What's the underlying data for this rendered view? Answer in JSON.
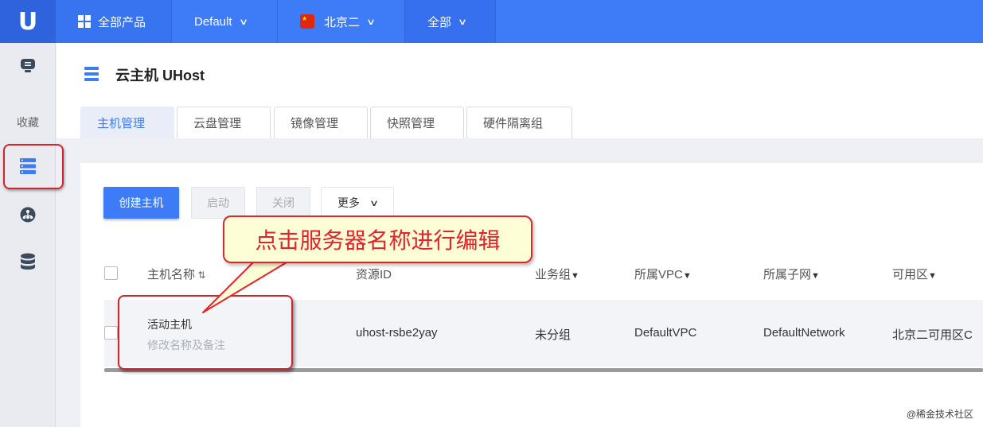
{
  "topbar": {
    "logo": "U",
    "products_label": "全部产品",
    "project_label": "Default",
    "region_label": "北京二",
    "scope_label": "全部"
  },
  "sidebar": {
    "favorites_label": "收藏"
  },
  "page": {
    "title": "云主机 UHost"
  },
  "tabs": [
    {
      "label": "主机管理"
    },
    {
      "label": "云盘管理"
    },
    {
      "label": "镜像管理"
    },
    {
      "label": "快照管理"
    },
    {
      "label": "硬件隔离组"
    }
  ],
  "toolbar": {
    "create_label": "创建主机",
    "start_label": "启动",
    "stop_label": "关闭",
    "more_label": "更多"
  },
  "table": {
    "columns": [
      "主机名称",
      "资源ID",
      "业务组",
      "所属VPC",
      "所属子网",
      "可用区"
    ],
    "rows": [
      {
        "name": "活动主机",
        "remark": "修改名称及备注",
        "id": "uhost-rsbe2yay",
        "group": "未分组",
        "vpc": "DefaultVPC",
        "subnet": "DefaultNetwork",
        "zone": "北京二可用区C"
      }
    ]
  },
  "annotation": {
    "callout_text": "点击服务器名称进行编辑"
  },
  "watermark": "@稀金技术社区",
  "colors": {
    "brand": "#3e7bf7",
    "highlight": "#d8222a",
    "callout_bg": "#fdfdd6"
  }
}
